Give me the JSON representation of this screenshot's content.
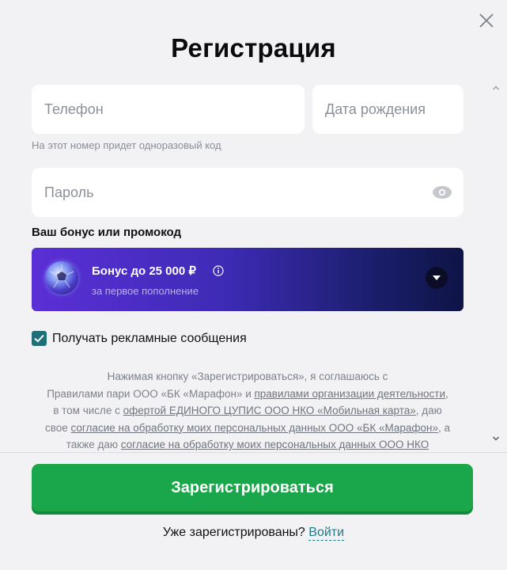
{
  "form": {
    "title": "Регистрация",
    "phone_placeholder": "Телефон",
    "birthdate_placeholder": "Дата рождения",
    "phone_hint": "На этот номер придет одноразовый код",
    "password_placeholder": "Пароль"
  },
  "bonus": {
    "heading": "Ваш бонус или промокод",
    "title": "Бонус до 25 000 ₽",
    "subtitle": "за первое пополнение"
  },
  "consent": {
    "checked": true,
    "label": "Получать рекламные сообщения"
  },
  "legal": {
    "t1": "Нажимая кнопку «Зарегистрироваться», я соглашаюсь с",
    "t2": "Правилами пари ООО «БК «Марафон» и ",
    "link1": "правилами организации деятельности",
    "t3": ",",
    "t4": "в том числе с ",
    "link2": "офертой ЕДИНОГО ЦУПИС ООО НКО «Мобильная карта»",
    "t5": ", даю",
    "t6": "свое ",
    "link3": "согласие на обработку моих персональных данных ООО «БК «Марафон»",
    "t7": ", а",
    "t8": "также даю ",
    "link4": "согласие на обработку моих персональных данных ООО НКО"
  },
  "footer": {
    "submit_label": "Зарегистрироваться",
    "already_text": "Уже зарегистрированы?",
    "login_link": "Войти"
  },
  "icons": {
    "close": "close-icon",
    "eye": "eye-icon",
    "info": "info-icon",
    "chevron": "chevron-down-icon",
    "check": "checkmark-icon"
  },
  "colors": {
    "accent_green": "#1aa64a",
    "checkbox_teal": "#1f6e78",
    "bonus_gradient_start": "#5b2fd6",
    "bonus_gradient_end": "#0e1446"
  }
}
